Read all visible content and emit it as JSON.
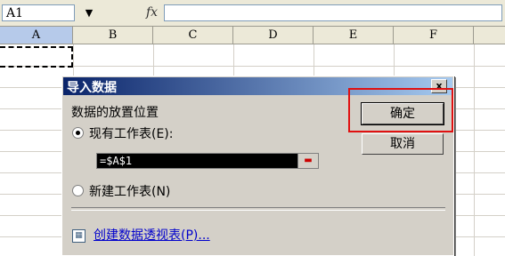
{
  "formula_bar": {
    "name_box": "A1",
    "fx_label": "fx",
    "formula": ""
  },
  "columns": [
    "A",
    "B",
    "C",
    "D",
    "E",
    "F"
  ],
  "active_column": "A",
  "dialog": {
    "title": "导入数据",
    "close_label": "x",
    "section_label": "数据的放置位置",
    "existing_sheet_label": "现有工作表(E):",
    "existing_sheet_checked": true,
    "reference_value": "=$A$1",
    "new_sheet_label": "新建工作表(N)",
    "new_sheet_checked": false,
    "pivot_link": "创建数据透视表(P)...",
    "ok_button": "确定",
    "cancel_button": "取消"
  },
  "colors": {
    "titlebar_start": "#0a246a",
    "titlebar_end": "#a6caf0",
    "highlight": "#e01010",
    "link": "#0000cc"
  },
  "icons": {
    "fx": "fx-icon",
    "dropdown": "chevron-down-icon",
    "ref_picker": "range-select-icon",
    "pivot": "pivot-table-icon"
  }
}
